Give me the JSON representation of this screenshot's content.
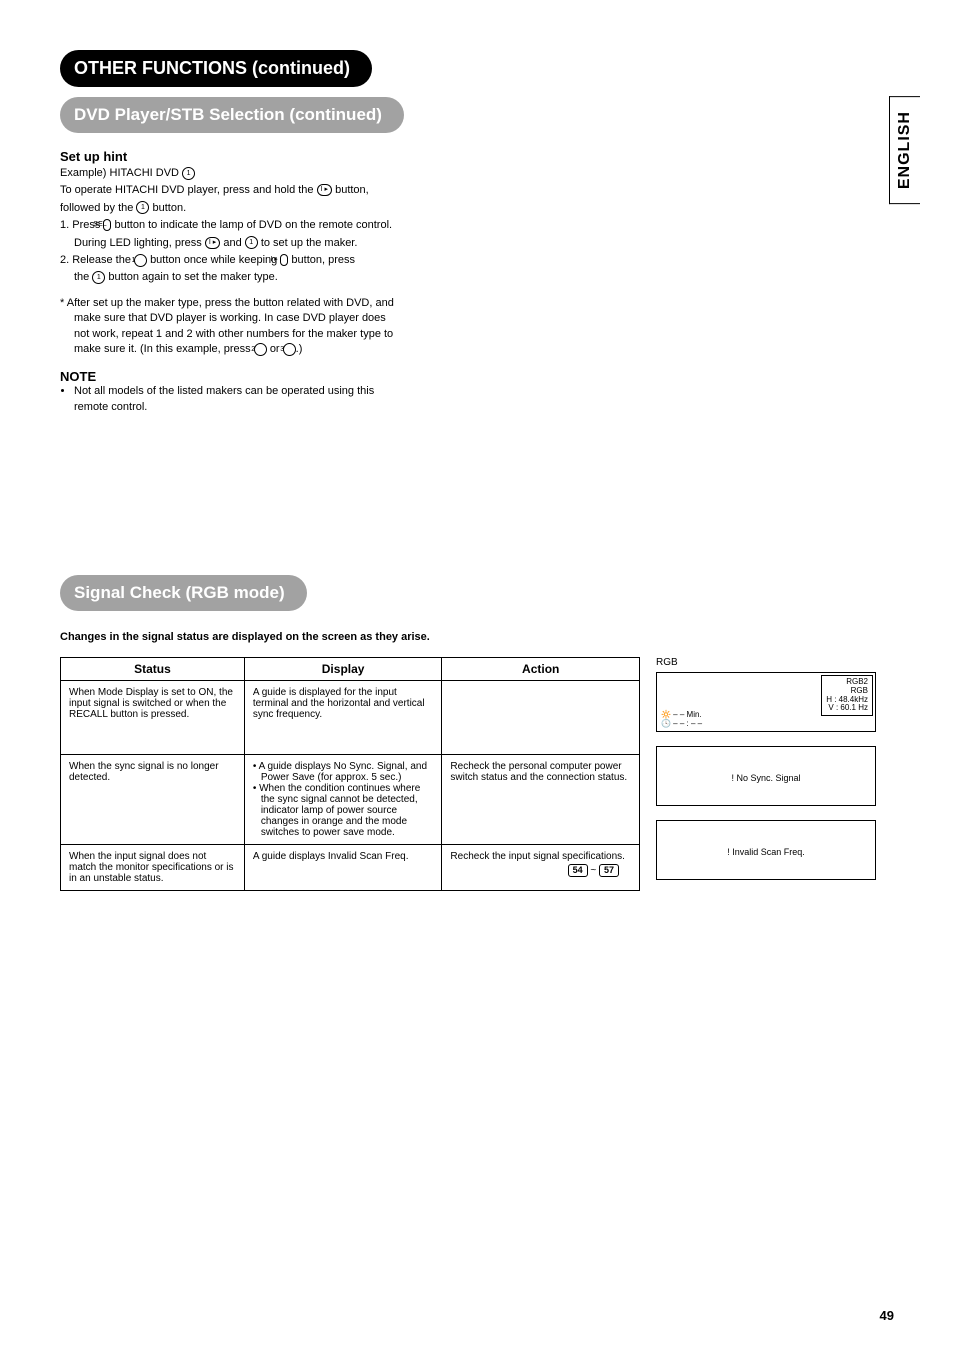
{
  "sideTab": "ENGLISH",
  "pageNumber": "49",
  "header1": "OTHER FUNCTIONS (continued)",
  "header2": "DVD Player/STB Selection (continued)",
  "setup": {
    "title": "Set up hint",
    "exampleLine": "Example) HITACHI DVD",
    "example_num": "1",
    "line1": "To operate HITACHI DVD player, press and hold the",
    "line1_btn": "I ▸",
    "line1_cont": "button,",
    "line2": "followed by the",
    "line2_btn": "1",
    "line2_cont": "button.",
    "step1a": "1. Press",
    "step1a_btn": "SEL",
    "step1a_cont": "button to indicate the lamp of DVD on the remote control.",
    "step1b": "During LED lighting, press",
    "step1b_btn1": "I ▸",
    "step1b_mid": "and",
    "step1b_btn2": "1",
    "step1b_cont": "to set up the maker.",
    "step2a": "2. Release the",
    "step2a_btn1": "1",
    "step2a_mid": "button once while keeping",
    "step2a_btn2": "I ▸",
    "step2a_cont": "button, press",
    "step2b": "the",
    "step2b_btn": "1",
    "step2b_cont": "button again to set the maker type.",
    "footnote": "* After set up the maker type, press the button related with DVD, and make sure that DVD player is working. In case DVD player does not work, repeat 1 and 2 with other numbers for the maker type to make sure it. (In this example, press",
    "footnote_btn2": "2",
    "footnote_or": "or",
    "footnote_btn3": "3",
    "footnote_end": ".)"
  },
  "note": {
    "title": "NOTE",
    "bullet": "Not all models of the listed makers can be operated using this remote control."
  },
  "signal": {
    "header": "Signal Check (RGB mode)",
    "intro": "Changes in the signal status are displayed on the screen as they arise.",
    "headers": {
      "status": "Status",
      "display": "Display",
      "action": "Action"
    },
    "rows": [
      {
        "status": "When Mode Display is set to ON, the input signal is switched or when the RECALL button is pressed.",
        "display": "A guide is displayed for the input terminal and the horizontal and vertical sync frequency.",
        "action": ""
      },
      {
        "status": "When the sync signal is no longer detected.",
        "display_b1": "A guide displays No Sync. Signal, and Power Save (for approx. 5 sec.)",
        "display_b2": "When the condition continues where the sync signal cannot be detected, indicator lamp of power source changes in orange and the mode switches to power save mode.",
        "action": "Recheck the personal computer power switch status and the connection status."
      },
      {
        "status": "When the input signal does not match the monitor specifications or is in an unstable status.",
        "display": "A guide displays Invalid Scan Freq.",
        "action": "Recheck the input signal specifications.",
        "action_key1": "54",
        "action_tilde": "~",
        "action_key2": "57"
      }
    ],
    "rgbLabel": "RGB",
    "osd1": {
      "l1": "RGB2",
      "l2": "RGB",
      "l3": "H : 48.4kHz",
      "l4": "V : 60.1 Hz",
      "min1": "🔆  – – Min.",
      "min2": "🕓  – – : – –"
    },
    "osd2": "! No Sync. Signal",
    "osd3": "! Invalid Scan Freq."
  }
}
